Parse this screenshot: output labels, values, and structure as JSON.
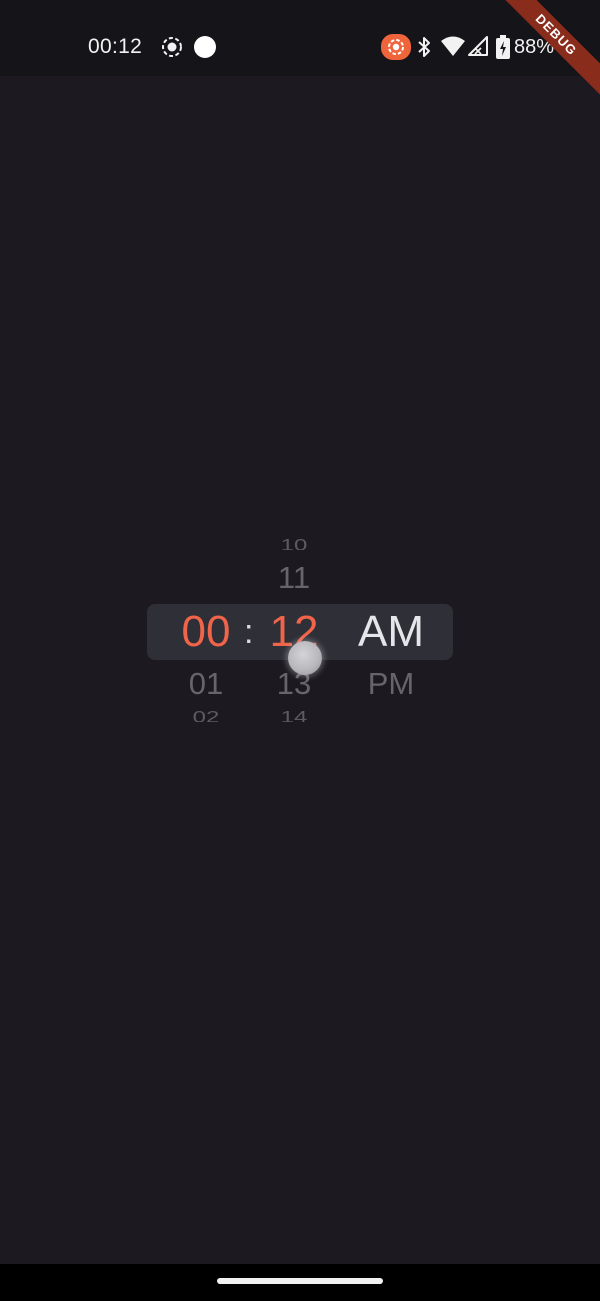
{
  "status_bar": {
    "time": "00:12",
    "battery_percent": "88%",
    "icons": [
      "screen-record-icon",
      "notification-dot-icon",
      "cast-icon",
      "bluetooth-icon",
      "wifi-icon",
      "signal-icon",
      "battery-icon"
    ],
    "cast_color": "#f0643c"
  },
  "debug_banner": "DEBUG",
  "time_picker": {
    "separator": ":",
    "accent_color": "#f0644a",
    "hours": {
      "selected": "00",
      "below": [
        "01",
        "02"
      ]
    },
    "minutes": {
      "above": [
        "10",
        "11"
      ],
      "selected": "12",
      "below": [
        "13",
        "14"
      ]
    },
    "period": {
      "selected": "AM",
      "below": [
        "PM"
      ]
    }
  }
}
